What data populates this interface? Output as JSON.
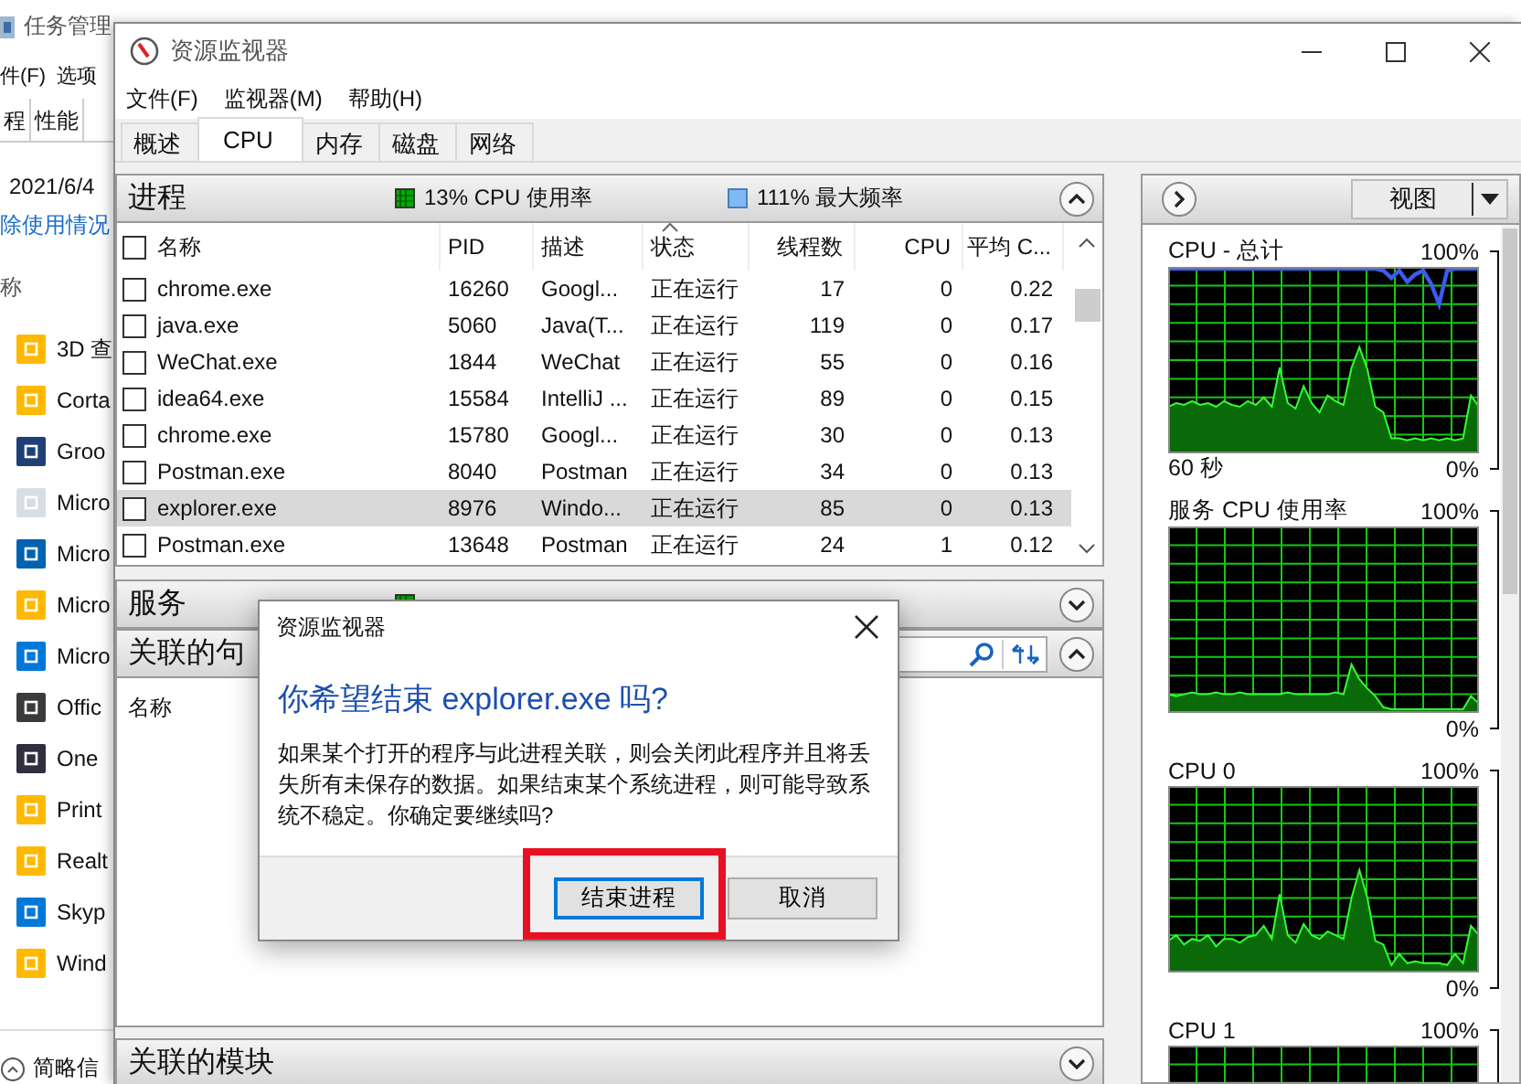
{
  "background_window": {
    "title": "任务管理",
    "menu": [
      "件(F)",
      "选项"
    ],
    "tabs": [
      {
        "label": "程",
        "selected": false
      },
      {
        "label": "性能",
        "selected": false
      }
    ],
    "date": "2021/6/4",
    "link": "除使用情况",
    "column": "称",
    "apps": [
      {
        "name": "3D 查",
        "color": "#ffb900"
      },
      {
        "name": "Corta",
        "color": "#ffb900"
      },
      {
        "name": "Groo",
        "color": "#1f3f77"
      },
      {
        "name": "Micro",
        "color": "#d8dde6"
      },
      {
        "name": "Micro",
        "color": "#0063b1"
      },
      {
        "name": "Micro",
        "color": "#ffb900"
      },
      {
        "name": "Micro",
        "color": "#0078d7"
      },
      {
        "name": "Offic",
        "color": "#3b3b3b"
      },
      {
        "name": "One",
        "color": "#2f2f3f"
      },
      {
        "name": "Print",
        "color": "#ffb900"
      },
      {
        "name": "Realt",
        "color": "#ffb900"
      },
      {
        "name": "Skyp",
        "color": "#0078d7"
      },
      {
        "name": "Wind",
        "color": "#ffb900"
      }
    ],
    "footer": "简略信"
  },
  "window": {
    "title": "资源监视器"
  },
  "menu": [
    "文件(F)",
    "监视器(M)",
    "帮助(H)"
  ],
  "tabs": [
    {
      "label": "概述",
      "selected": false
    },
    {
      "label": "CPU",
      "selected": true
    },
    {
      "label": "内存",
      "selected": false
    },
    {
      "label": "磁盘",
      "selected": false
    },
    {
      "label": "网络",
      "selected": false
    }
  ],
  "processes": {
    "title": "进程",
    "cpu_usage": "13% CPU 使用率",
    "max_frequency": "111% 最大频率",
    "expanded": true,
    "all_checked": false,
    "columns": [
      {
        "label": "名称",
        "sorted": false
      },
      {
        "label": "PID",
        "sorted": false
      },
      {
        "label": "描述",
        "sorted": false
      },
      {
        "label": "状态",
        "sorted": true
      },
      {
        "label": "线程数",
        "sorted": false
      },
      {
        "label": "CPU",
        "sorted": false
      },
      {
        "label": "平均 C...",
        "sorted": false
      }
    ],
    "rows": [
      {
        "checked": false,
        "selected": false,
        "cells": [
          "chrome.exe",
          "16260",
          "Googl...",
          "正在运行",
          "17",
          "0",
          "0.22"
        ]
      },
      {
        "checked": false,
        "selected": false,
        "cells": [
          "java.exe",
          "5060",
          "Java(T...",
          "正在运行",
          "119",
          "0",
          "0.17"
        ]
      },
      {
        "checked": false,
        "selected": false,
        "cells": [
          "WeChat.exe",
          "1844",
          "WeChat",
          "正在运行",
          "55",
          "0",
          "0.16"
        ]
      },
      {
        "checked": false,
        "selected": false,
        "cells": [
          "idea64.exe",
          "15584",
          "IntelliJ ...",
          "正在运行",
          "89",
          "0",
          "0.15"
        ]
      },
      {
        "checked": false,
        "selected": false,
        "cells": [
          "chrome.exe",
          "15780",
          "Googl...",
          "正在运行",
          "30",
          "0",
          "0.13"
        ]
      },
      {
        "checked": false,
        "selected": false,
        "cells": [
          "Postman.exe",
          "8040",
          "Postman",
          "正在运行",
          "34",
          "0",
          "0.13"
        ]
      },
      {
        "checked": false,
        "selected": true,
        "cells": [
          "explorer.exe",
          "8976",
          "Windo...",
          "正在运行",
          "85",
          "0",
          "0.13"
        ]
      },
      {
        "checked": false,
        "selected": false,
        "cells": [
          "Postman.exe",
          "13648",
          "Postman",
          "正在运行",
          "24",
          "1",
          "0.12"
        ]
      }
    ]
  },
  "services": {
    "title": "服务",
    "expanded": false
  },
  "handles": {
    "title": "关联的句",
    "expanded": true,
    "column": "名称"
  },
  "modules": {
    "title": "关联的模块",
    "expanded": false
  },
  "right_panel": {
    "view_button": "视图",
    "graphs": [
      {
        "kind": "total",
        "label": "CPU - 总计",
        "max": "100%",
        "time": "60 秒",
        "min": "0%"
      },
      {
        "kind": "services",
        "label": "服务 CPU 使用率",
        "max": "100%",
        "min": "0%"
      },
      {
        "kind": "core",
        "label": "CPU 0",
        "max": "100%",
        "min": "0%"
      },
      {
        "kind": "core2",
        "label": "CPU 1",
        "max": "100%"
      }
    ]
  },
  "dialog": {
    "title": "资源监视器",
    "heading": "你希望结束 explorer.exe 吗?",
    "message": "如果某个打开的程序与此进程关联，则会关闭此程序并且将丢失所有未保存的数据。如果结束某个系统进程，则可能导致系统不稳定。你确定要继续吗?",
    "buttons": [
      {
        "label": "结束进程",
        "focused": true,
        "highlighted": true
      },
      {
        "label": "取消",
        "focused": false,
        "highlighted": false
      }
    ]
  }
}
